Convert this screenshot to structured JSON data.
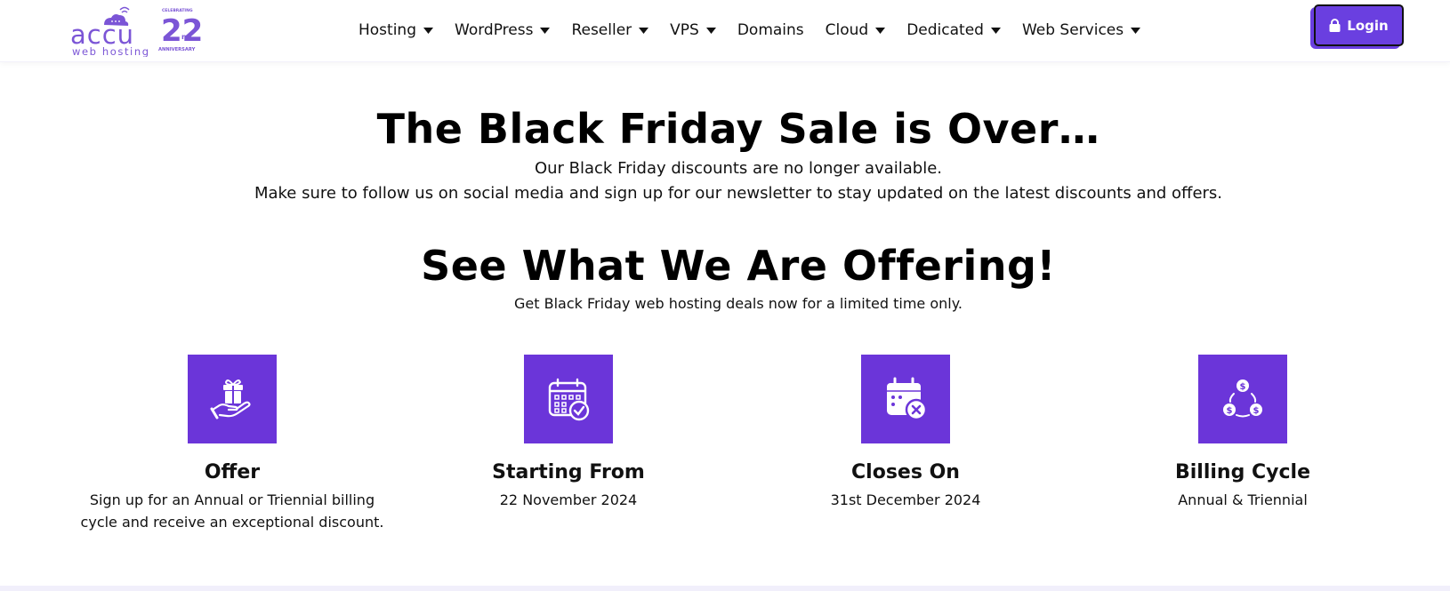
{
  "logo": {
    "brand": "accu",
    "tagline": "web hosting",
    "badge_top": "CELEBRATING",
    "badge_number": "22",
    "badge_suffix": "nd",
    "badge_bottom": "ANNIVERSARY"
  },
  "nav": {
    "items": [
      {
        "label": "Hosting",
        "has_dropdown": true
      },
      {
        "label": "WordPress",
        "has_dropdown": true
      },
      {
        "label": "Reseller",
        "has_dropdown": true
      },
      {
        "label": "VPS",
        "has_dropdown": true
      },
      {
        "label": "Domains",
        "has_dropdown": false
      },
      {
        "label": "Cloud",
        "has_dropdown": true
      },
      {
        "label": "Dedicated",
        "has_dropdown": true
      },
      {
        "label": "Web Services",
        "has_dropdown": true
      }
    ],
    "login_label": "Login"
  },
  "hero": {
    "title": "The Black Friday Sale is Over…",
    "line1": "Our Black Friday discounts are no longer available.",
    "line2": "Make sure to follow us on social media and sign up for our newsletter to stay updated on the latest discounts and offers."
  },
  "offering": {
    "title": "See What We Are Offering!",
    "subtitle": "Get Black Friday web hosting deals now for a limited time only."
  },
  "features": [
    {
      "icon": "gift-hand-icon",
      "title": "Offer",
      "desc_line1": "Sign up for an Annual or Triennial billing",
      "desc_line2": "cycle and receive an exceptional discount."
    },
    {
      "icon": "calendar-check-icon",
      "title": "Starting From",
      "desc_line1": "22 November 2024",
      "desc_line2": ""
    },
    {
      "icon": "calendar-x-icon",
      "title": "Closes On",
      "desc_line1": "31st December 2024",
      "desc_line2": ""
    },
    {
      "icon": "dollar-cycle-icon",
      "title": "Billing Cycle",
      "desc_line1": "Annual & Triennial",
      "desc_line2": ""
    }
  ],
  "colors": {
    "accent": "#6b35d9",
    "login": "#6a3fe0",
    "text": "#111111"
  }
}
